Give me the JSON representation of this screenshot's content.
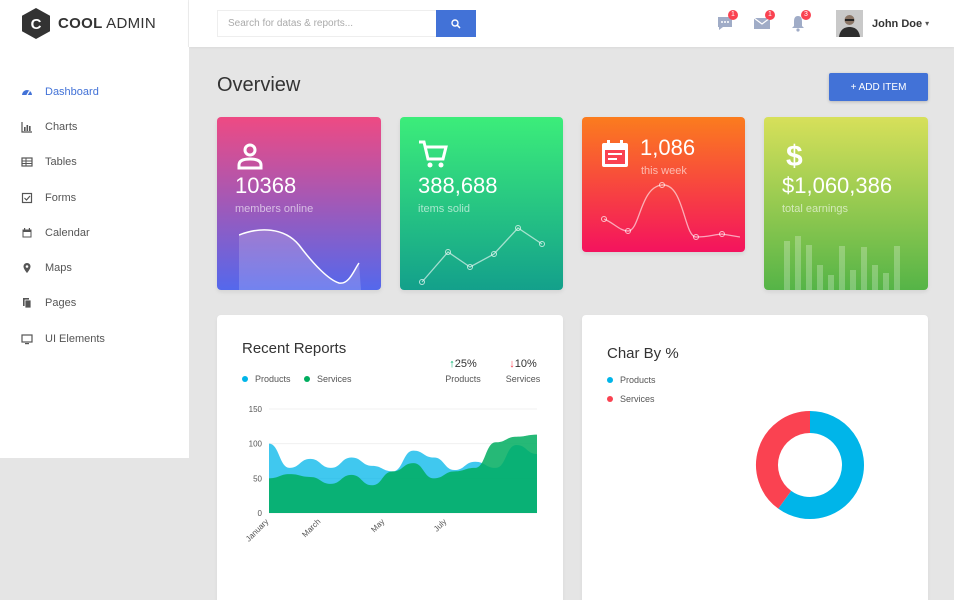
{
  "brand": {
    "logo_bold": "COOL",
    "logo_rest": "ADMIN",
    "logo_letter": "C"
  },
  "header": {
    "search_placeholder": "Search for datas & reports...",
    "badges": {
      "chat": "1",
      "mail": "1",
      "bell": "3"
    },
    "user_name": "John Doe"
  },
  "sidebar": {
    "items": [
      {
        "label": "Dashboard",
        "icon": "dashboard-icon",
        "active": true
      },
      {
        "label": "Charts",
        "icon": "bar-chart-icon"
      },
      {
        "label": "Tables",
        "icon": "table-icon"
      },
      {
        "label": "Forms",
        "icon": "checkbox-icon"
      },
      {
        "label": "Calendar",
        "icon": "calendar-icon"
      },
      {
        "label": "Maps",
        "icon": "map-marker-icon"
      },
      {
        "label": "Pages",
        "icon": "pages-icon"
      },
      {
        "label": "UI Elements",
        "icon": "desktop-icon"
      }
    ]
  },
  "main": {
    "title": "Overview",
    "add_button": "+ ADD ITEM"
  },
  "stats": [
    {
      "value": "10368",
      "label": "members online",
      "icon": "user-icon"
    },
    {
      "value": "388,688",
      "label": "items solid",
      "icon": "cart-icon"
    },
    {
      "value": "1,086",
      "label": "this week",
      "icon": "calendar-icon"
    },
    {
      "value": "$1,060,386",
      "label": "total earnings",
      "icon": "dollar-icon"
    }
  ],
  "recent_reports": {
    "title": "Recent Reports",
    "legend": [
      "Products",
      "Services"
    ],
    "products_pct": "25%",
    "products_label": "Products",
    "services_pct": "10%",
    "services_label": "Services"
  },
  "char_by": {
    "title": "Char By %",
    "legend": [
      "Products",
      "Services"
    ]
  },
  "colors": {
    "accent": "#4272d7",
    "products": "#00b5e9",
    "services": "#00ad5f",
    "donut_services": "#fa4251"
  },
  "chart_data": [
    {
      "type": "area",
      "title": "Recent Reports",
      "categories": [
        "January",
        "March",
        "May",
        "July"
      ],
      "ylim": [
        0,
        150
      ],
      "yticks": [
        "150",
        "100",
        "50",
        "0"
      ],
      "series": [
        {
          "name": "Products",
          "values": [
            100,
            65,
            78,
            65,
            80,
            68,
            60,
            90,
            80,
            62,
            74,
            65,
            98,
            85
          ]
        },
        {
          "name": "Services",
          "values": [
            50,
            56,
            52,
            42,
            55,
            40,
            60,
            72,
            50,
            60,
            65,
            102,
            110,
            113
          ]
        }
      ]
    },
    {
      "type": "pie",
      "title": "Char By %",
      "labels": [
        "Products",
        "Services"
      ],
      "values": [
        60,
        40
      ]
    }
  ]
}
